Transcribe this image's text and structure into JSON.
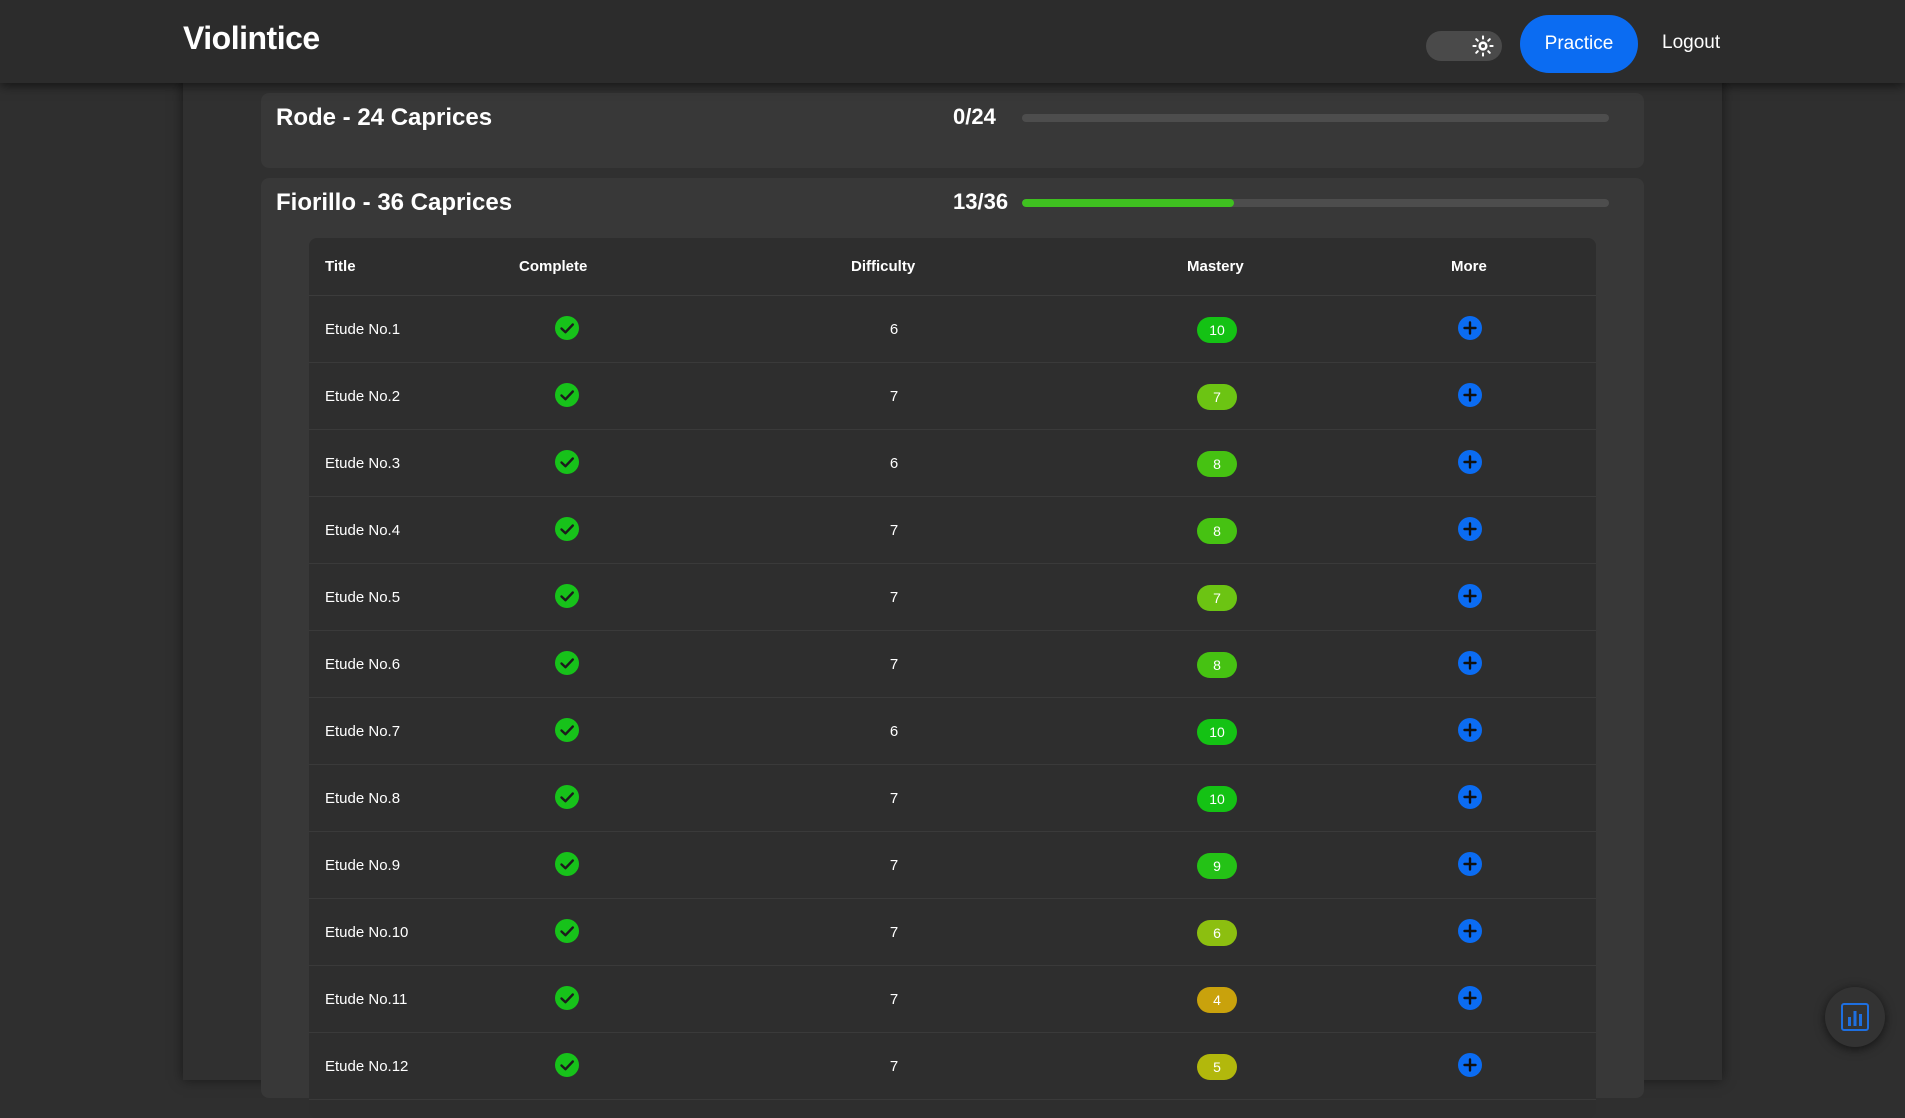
{
  "app": {
    "brand": "Violintice"
  },
  "nav": {
    "theme_toggle_icon": "sun-icon",
    "practice_label": "Practice",
    "logout_label": "Logout"
  },
  "colors": {
    "primary_blue": "#0b6cf2",
    "progress_green": "#3fc020",
    "check_green": "#17c21a"
  },
  "courses": [
    {
      "title": "Rode - 24 Caprices",
      "count": "0/24",
      "progress_fraction": 0.0
    },
    {
      "title": "Fiorillo - 36 Caprices",
      "count": "13/36",
      "progress_fraction": 0.3611
    }
  ],
  "table": {
    "headers": {
      "title": "Title",
      "complete": "Complete",
      "difficulty": "Difficulty",
      "mastery": "Mastery",
      "more": "More"
    },
    "rows": [
      {
        "title": "Etude No.1",
        "complete": true,
        "difficulty": "6",
        "mastery": "10",
        "mastery_color": "#14c214"
      },
      {
        "title": "Etude No.2",
        "complete": true,
        "difficulty": "7",
        "mastery": "7",
        "mastery_color": "#6cc413"
      },
      {
        "title": "Etude No.3",
        "complete": true,
        "difficulty": "6",
        "mastery": "8",
        "mastery_color": "#46c212"
      },
      {
        "title": "Etude No.4",
        "complete": true,
        "difficulty": "7",
        "mastery": "8",
        "mastery_color": "#46c212"
      },
      {
        "title": "Etude No.5",
        "complete": true,
        "difficulty": "7",
        "mastery": "7",
        "mastery_color": "#6cc413"
      },
      {
        "title": "Etude No.6",
        "complete": true,
        "difficulty": "7",
        "mastery": "8",
        "mastery_color": "#46c212"
      },
      {
        "title": "Etude No.7",
        "complete": true,
        "difficulty": "6",
        "mastery": "10",
        "mastery_color": "#14c214"
      },
      {
        "title": "Etude No.8",
        "complete": true,
        "difficulty": "7",
        "mastery": "10",
        "mastery_color": "#14c214"
      },
      {
        "title": "Etude No.9",
        "complete": true,
        "difficulty": "7",
        "mastery": "9",
        "mastery_color": "#24c216"
      },
      {
        "title": "Etude No.10",
        "complete": true,
        "difficulty": "7",
        "mastery": "6",
        "mastery_color": "#8cbf10"
      },
      {
        "title": "Etude No.11",
        "complete": true,
        "difficulty": "7",
        "mastery": "4",
        "mastery_color": "#c9a20c"
      },
      {
        "title": "Etude No.12",
        "complete": true,
        "difficulty": "7",
        "mastery": "5",
        "mastery_color": "#b2b80c"
      }
    ]
  },
  "fab": {
    "icon": "bar-chart-icon"
  }
}
